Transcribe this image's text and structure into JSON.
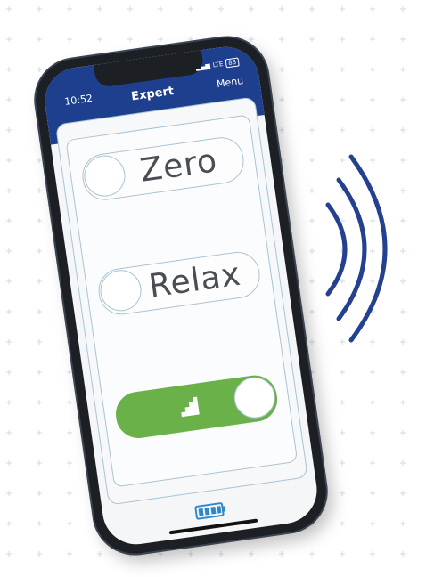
{
  "status_bar": {
    "time": "10:52",
    "network": "LTE",
    "battery": "83"
  },
  "app_bar": {
    "title": "Expert",
    "menu_label": "Menu"
  },
  "toggles": [
    {
      "label": "Zero",
      "state": "off"
    },
    {
      "label": "Relax",
      "state": "off"
    },
    {
      "icon": "stairs-icon",
      "state": "on"
    }
  ],
  "colors": {
    "app_bar": "#1e3f8e",
    "toggle_on": "#6bb149",
    "outline": "#a8c4d4",
    "signal_waves": "#24408f",
    "battery": "#2f87c9"
  },
  "battery_icon": "battery-full-icon",
  "signal_icon": "wireless-signal-icon"
}
